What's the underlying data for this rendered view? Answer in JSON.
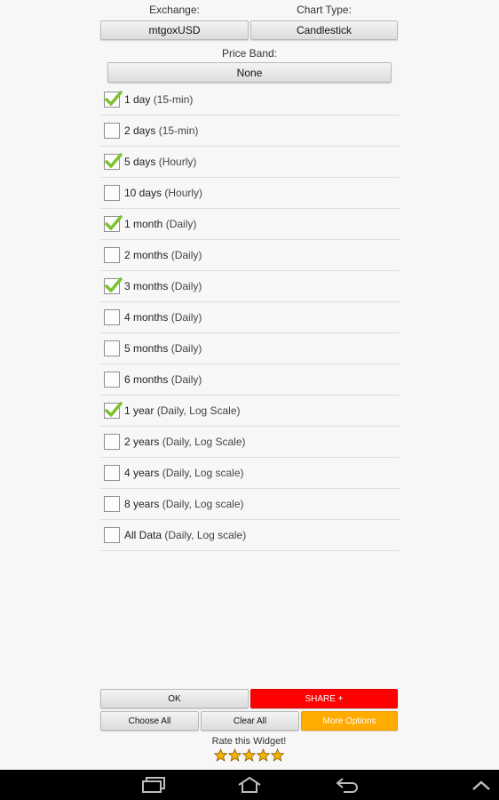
{
  "exchange": {
    "label": "Exchange:",
    "value": "mtgoxUSD"
  },
  "chart_type": {
    "label": "Chart Type:",
    "value": "Candlestick"
  },
  "price_band": {
    "label": "Price Band:",
    "value": "None"
  },
  "periods": [
    {
      "name": "1 day",
      "detail": "(15-min)",
      "checked": true
    },
    {
      "name": "2 days",
      "detail": "(15-min)",
      "checked": false
    },
    {
      "name": "5 days",
      "detail": "(Hourly)",
      "checked": true
    },
    {
      "name": "10 days",
      "detail": "(Hourly)",
      "checked": false
    },
    {
      "name": "1 month",
      "detail": "(Daily)",
      "checked": true
    },
    {
      "name": "2 months",
      "detail": "(Daily)",
      "checked": false
    },
    {
      "name": "3 months",
      "detail": "(Daily)",
      "checked": true
    },
    {
      "name": "4 months",
      "detail": "(Daily)",
      "checked": false
    },
    {
      "name": "5 months",
      "detail": "(Daily)",
      "checked": false
    },
    {
      "name": "6 months",
      "detail": "(Daily)",
      "checked": false
    },
    {
      "name": "1 year",
      "detail": "(Daily, Log Scale)",
      "checked": true
    },
    {
      "name": "2 years",
      "detail": "(Daily, Log Scale)",
      "checked": false
    },
    {
      "name": "4 years",
      "detail": "(Daily, Log scale)",
      "checked": false
    },
    {
      "name": "8 years",
      "detail": "(Daily, Log scale)",
      "checked": false
    },
    {
      "name": "All Data",
      "detail": "(Daily, Log scale)",
      "checked": false
    }
  ],
  "buttons": {
    "ok": "OK",
    "share": "SHARE +",
    "choose_all": "Choose All",
    "clear_all": "Clear All",
    "more_options": "More Options"
  },
  "rate": {
    "label": "Rate this Widget!",
    "stars": 5
  },
  "colors": {
    "share": "#ff0000",
    "more_options": "#ffab00",
    "check": "#7cc22e",
    "star": "#f5b400",
    "navbar": "#000000"
  },
  "navbar": {
    "icons": [
      "recent-apps-icon",
      "home-icon",
      "back-icon",
      "chevron-up-icon"
    ]
  }
}
